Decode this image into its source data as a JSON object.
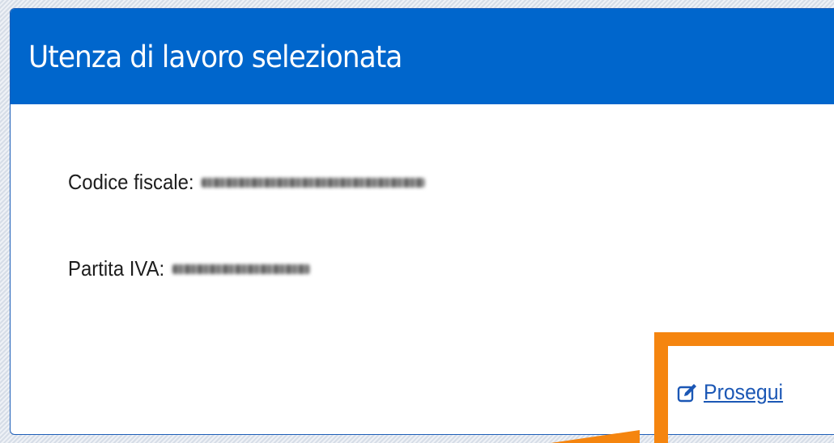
{
  "dialog": {
    "title": "Utenza di lavoro selezionata"
  },
  "fields": {
    "codice_fiscale_label": "Codice fiscale:",
    "partita_iva_label": "Partita IVA:"
  },
  "action": {
    "label": "Prosegui",
    "icon": "edit-icon"
  },
  "colors": {
    "header_bg": "#0066cc",
    "link": "#1b57b5",
    "highlight": "#f5850f"
  }
}
